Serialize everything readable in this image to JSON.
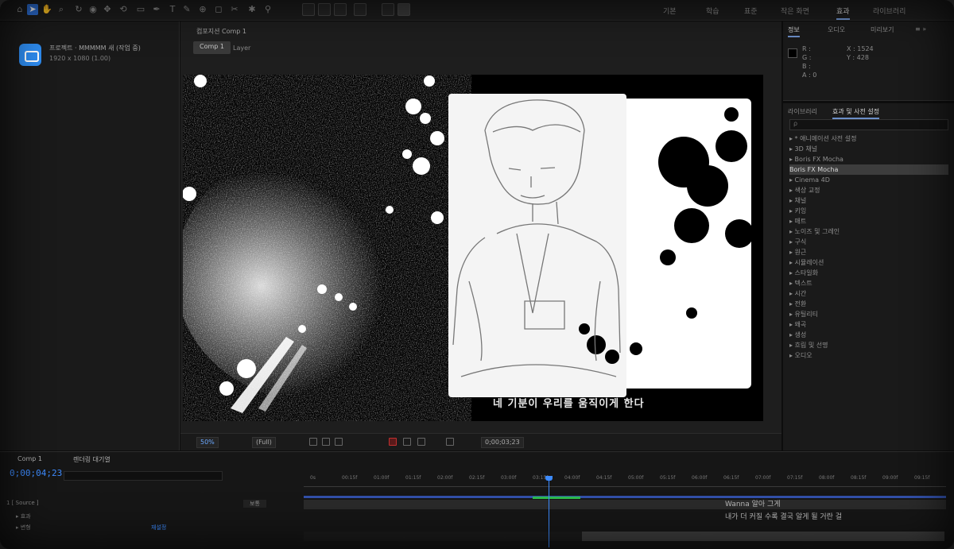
{
  "toolbar": {
    "tools": [
      "home-icon",
      "select-icon",
      "hand-icon",
      "zoom-icon",
      "rotate-icon",
      "camera-icon",
      "pan-icon",
      "rectangle-icon",
      "pen-icon",
      "text-icon",
      "brush-icon",
      "clone-icon",
      "eraser-icon",
      "roto-icon",
      "puppet-icon"
    ],
    "workspaces": [
      "기본",
      "학습",
      "표준",
      "작은 화면",
      "효과",
      "라이브러리"
    ],
    "active_workspace": "효과"
  },
  "project": {
    "title": "프로젝트 · MMMMM 새 (작업 중)",
    "subtitle": "1920 x 1080 (1.00)"
  },
  "viewer": {
    "tab_label": "컴포지션 Comp 1",
    "crumb_active": "Comp 1",
    "crumb_next": "Layer",
    "subtitle_overlay": "네 기분이 우리를 움직이게 한다",
    "zoom": "50%",
    "resolution": "(Full)",
    "timecode_button": "0;00;03;23"
  },
  "info_panel": {
    "tabs": [
      "정보",
      "오디오",
      "미리보기"
    ],
    "active_tab": "정보",
    "rows": [
      "R :",
      "G :",
      "B :",
      "A : 0"
    ],
    "coords": [
      "X : 1524",
      "Y : 428"
    ]
  },
  "effects_panel": {
    "tabs": [
      "라이브러리",
      "효과 및 사전 설정"
    ],
    "active_tab": "효과 및 사전 설정",
    "search_placeholder": "ρ",
    "items": [
      "▸ * 애니메이션 사전 설정",
      "▸ 3D 채널",
      "▸ Boris FX Mocha",
      "  Boris FX Mocha",
      "▸ Cinema 4D",
      "▸ 색상 교정",
      "▸ 채널",
      "▸ 키잉",
      "▸ 매트",
      "▸ 노이즈 및 그레인",
      "▸ 구식",
      "▸ 원근",
      "▸ 시뮬레이션",
      "▸ 스타일화",
      "▸ 텍스트",
      "▸ 시간",
      "▸ 전환",
      "▸ 유틸리티",
      "▸ 왜곡",
      "▸ 생성",
      "▸ 흐림 및 선명",
      "▸ 오디오"
    ],
    "selected_index": 3
  },
  "timeline": {
    "comp_tab": "Comp 1",
    "render_tab": "렌더링 대기열",
    "timecode": "0;00;04;23",
    "ruler_ticks": [
      "0s",
      "00:15f",
      "01:00f",
      "01:15f",
      "02:00f",
      "02:15f",
      "03:00f",
      "03:15f",
      "04:00f",
      "04:15f",
      "05:00f",
      "05:15f",
      "06:00f",
      "06:15f",
      "07:00f",
      "07:15f",
      "08:00f",
      "08:15f",
      "09:00f",
      "09:15f"
    ],
    "layers": [
      {
        "name": "1  [ Source ]",
        "mode": "보통"
      },
      {
        "name": "   ▸ 효과",
        "mode": ""
      },
      {
        "name": "   ▸ 변형",
        "mode": "재설정"
      }
    ],
    "subtitle_1": "Wanna 알아 그게",
    "subtitle_2": "내가 더 커질 수록 결국 알게 될 거란 걸"
  }
}
